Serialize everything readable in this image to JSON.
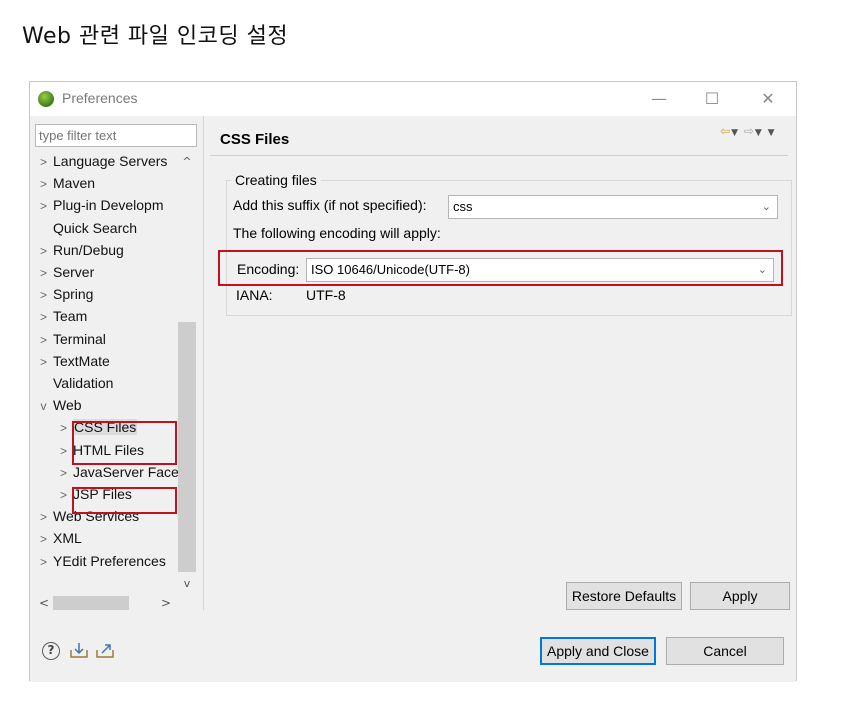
{
  "heading": "Web 관련 파일 인코딩 설정",
  "window": {
    "title": "Preferences",
    "minimize_glyph": "—",
    "maximize_glyph": "☐",
    "close_glyph": "✕"
  },
  "filter": {
    "placeholder": "type filter text"
  },
  "tree": [
    {
      "label": "Language Servers",
      "twisty": ">",
      "indent": 0
    },
    {
      "label": "Maven",
      "twisty": ">",
      "indent": 0
    },
    {
      "label": "Plug-in Developm",
      "twisty": ">",
      "indent": 0
    },
    {
      "label": "Quick Search",
      "twisty": "",
      "indent": 0
    },
    {
      "label": "Run/Debug",
      "twisty": ">",
      "indent": 0
    },
    {
      "label": "Server",
      "twisty": ">",
      "indent": 0
    },
    {
      "label": "Spring",
      "twisty": ">",
      "indent": 0
    },
    {
      "label": "Team",
      "twisty": ">",
      "indent": 0
    },
    {
      "label": "Terminal",
      "twisty": ">",
      "indent": 0
    },
    {
      "label": "TextMate",
      "twisty": ">",
      "indent": 0
    },
    {
      "label": "Validation",
      "twisty": "",
      "indent": 0
    },
    {
      "label": "Web",
      "twisty": "v",
      "indent": 0
    },
    {
      "label": "CSS Files",
      "twisty": ">",
      "indent": 1,
      "selected": true
    },
    {
      "label": "HTML Files",
      "twisty": ">",
      "indent": 1
    },
    {
      "label": "JavaServer Face",
      "twisty": ">",
      "indent": 1
    },
    {
      "label": "JSP Files",
      "twisty": ">",
      "indent": 1
    },
    {
      "label": "Web Services",
      "twisty": ">",
      "indent": 0
    },
    {
      "label": "XML",
      "twisty": ">",
      "indent": 0
    },
    {
      "label": "YEdit Preferences",
      "twisty": ">",
      "indent": 0
    }
  ],
  "page": {
    "title": "CSS Files",
    "group_title": "Creating files",
    "suffix_label": "Add this suffix (if not specified):",
    "suffix_value": "css",
    "encoding_note": "The following encoding will apply:",
    "encoding_label": "Encoding:",
    "encoding_value": "ISO 10646/Unicode(UTF-8)",
    "iana_label": "IANA:",
    "iana_value": "UTF-8"
  },
  "buttons": {
    "restore_defaults": "Restore Defaults",
    "apply": "Apply",
    "apply_and_close": "Apply and Close",
    "cancel": "Cancel"
  },
  "icons": {
    "help": "?",
    "app": "eclipse-icon",
    "import": "import-icon",
    "export": "export-icon"
  },
  "colors": {
    "highlight_border": "#c0111f",
    "primary_button_border": "#0078d7"
  }
}
